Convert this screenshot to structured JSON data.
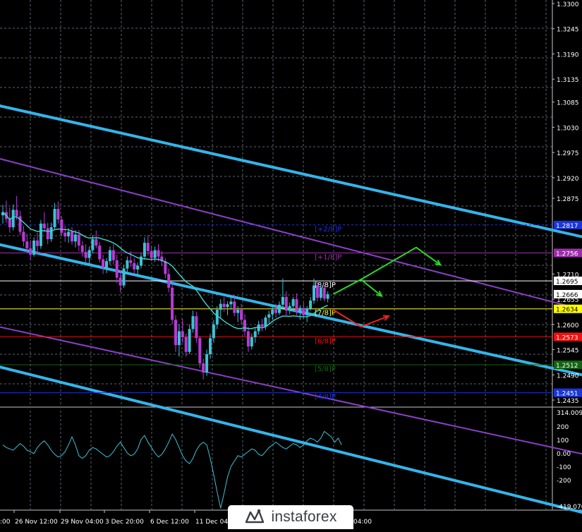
{
  "colors": {
    "background": "#000000",
    "grid": "#5a6670",
    "candle_up": "#3ec1d6",
    "candle_down": "#b73bd6",
    "ma": "#3fd8cf",
    "channel_main": "#33b5ea",
    "channel_inner": "#8a3fc6",
    "axis_text": "#ffffff",
    "cci": "#3ec1d6",
    "arrow_up": "#22dd22",
    "arrow_down": "#ee2222"
  },
  "chart_data": [
    {
      "type": "candlestick",
      "instrument_note": "",
      "x_ticks": [
        "26 Nov 12:00",
        "29 Nov 04:00",
        "3 Dec 20:00",
        "6 Dec 12:00",
        "11 Dec 04:00",
        "04:00"
      ],
      "x_tick_first": ":00",
      "ylim": [
        1.2435,
        1.33
      ],
      "y_ticks": [
        "1.3300",
        "1.3245",
        "1.3190",
        "1.3135",
        "1.3085",
        "1.3030",
        "1.2975",
        "1.2920",
        "1.2875",
        "1.2710",
        "1.2655",
        "1.2600",
        "1.2545",
        "1.2490",
        "1.2435"
      ],
      "price_tags": [
        {
          "value": "1.2695",
          "bg": "#ffffff",
          "fg": "#000000"
        },
        {
          "value": "1.2666",
          "bg": "#ffffff",
          "fg": "#000000"
        },
        {
          "value": "1.2634",
          "bg": "#ffff00",
          "fg": "#000000"
        },
        {
          "value": "1.2573",
          "bg": "#ee1111",
          "fg": "#ffffff"
        },
        {
          "value": "1.2512",
          "bg": "#126312",
          "fg": "#ffffff"
        },
        {
          "value": "1.2451",
          "bg": "#1a35d8",
          "fg": "#ffffff"
        },
        {
          "value": "1.2756",
          "bg": "#9b2fa8",
          "fg": "#ffffff"
        },
        {
          "value": "1.2817",
          "bg": "#1a35d8",
          "fg": "#ffffff"
        }
      ],
      "murray_levels": [
        {
          "label": "[+2/8]P",
          "value": 1.2817,
          "color": "#2233dd",
          "style": "dash"
        },
        {
          "label": "[+1/8]P",
          "value": 1.2756,
          "color": "#a02fb0",
          "style": "solid"
        },
        {
          "label": "[8/8]P",
          "value": 1.2695,
          "color": "#ffffff",
          "style": "solid"
        },
        {
          "label": "[7/8]P",
          "value": 1.2634,
          "color": "#ffff33",
          "style": "solid"
        },
        {
          "label": "[6/8]P",
          "value": 1.2573,
          "color": "#ee1111",
          "style": "solid"
        },
        {
          "label": "[5/8]P",
          "value": 1.2512,
          "color": "#126312",
          "style": "solid"
        },
        {
          "label": "[4/8]P",
          "value": 1.2451,
          "color": "#1a35d8",
          "style": "solid"
        }
      ],
      "last_price": 1.2666,
      "candles": [
        [
          1.2838,
          1.2861,
          1.282,
          1.2845
        ],
        [
          1.2845,
          1.287,
          1.2822,
          1.283
        ],
        [
          1.283,
          1.2855,
          1.28,
          1.2812
        ],
        [
          1.2812,
          1.2862,
          1.2805,
          1.285
        ],
        [
          1.285,
          1.288,
          1.2828,
          1.2836
        ],
        [
          1.2836,
          1.2848,
          1.2795,
          1.2802
        ],
        [
          1.2802,
          1.2815,
          1.277,
          1.2781
        ],
        [
          1.2781,
          1.2798,
          1.2758,
          1.2766
        ],
        [
          1.2766,
          1.2784,
          1.274,
          1.2752
        ],
        [
          1.2752,
          1.279,
          1.2748,
          1.2783
        ],
        [
          1.2783,
          1.28,
          1.276,
          1.2771
        ],
        [
          1.2771,
          1.2828,
          1.2765,
          1.282
        ],
        [
          1.282,
          1.2845,
          1.2802,
          1.281
        ],
        [
          1.281,
          1.2822,
          1.2775,
          1.2786
        ],
        [
          1.2786,
          1.2822,
          1.278,
          1.2812
        ],
        [
          1.2812,
          1.2865,
          1.2806,
          1.2852
        ],
        [
          1.2852,
          1.2868,
          1.282,
          1.2829
        ],
        [
          1.2829,
          1.2836,
          1.2792,
          1.28
        ],
        [
          1.28,
          1.2815,
          1.278,
          1.2792
        ],
        [
          1.2792,
          1.281,
          1.2778,
          1.2802
        ],
        [
          1.2802,
          1.2812,
          1.2774,
          1.2781
        ],
        [
          1.2781,
          1.2806,
          1.2768,
          1.2796
        ],
        [
          1.2796,
          1.2806,
          1.276,
          1.2772
        ],
        [
          1.2772,
          1.2782,
          1.2748,
          1.2758
        ],
        [
          1.2758,
          1.2775,
          1.2735,
          1.2745
        ],
        [
          1.2745,
          1.277,
          1.2732,
          1.2762
        ],
        [
          1.2762,
          1.2795,
          1.2755,
          1.2786
        ],
        [
          1.2786,
          1.2805,
          1.2766,
          1.2772
        ],
        [
          1.2772,
          1.278,
          1.2735,
          1.2742
        ],
        [
          1.2742,
          1.2752,
          1.271,
          1.2724
        ],
        [
          1.2724,
          1.2745,
          1.2712,
          1.2738
        ],
        [
          1.2738,
          1.277,
          1.273,
          1.2762
        ],
        [
          1.2762,
          1.2775,
          1.273,
          1.274
        ],
        [
          1.274,
          1.2752,
          1.269,
          1.2702
        ],
        [
          1.2702,
          1.2718,
          1.267,
          1.2685
        ],
        [
          1.2685,
          1.273,
          1.268,
          1.2722
        ],
        [
          1.2722,
          1.2748,
          1.271,
          1.274
        ],
        [
          1.274,
          1.276,
          1.2725,
          1.2734
        ],
        [
          1.2734,
          1.2745,
          1.2712,
          1.272
        ],
        [
          1.272,
          1.2735,
          1.2705,
          1.2728
        ],
        [
          1.2728,
          1.2755,
          1.2722,
          1.2748
        ],
        [
          1.2748,
          1.279,
          1.2742,
          1.2778
        ],
        [
          1.2778,
          1.2795,
          1.275,
          1.276
        ],
        [
          1.276,
          1.2772,
          1.2738,
          1.2745
        ],
        [
          1.2745,
          1.277,
          1.2736,
          1.2762
        ],
        [
          1.2762,
          1.2775,
          1.2738,
          1.2748
        ],
        [
          1.2748,
          1.276,
          1.2728,
          1.2738
        ],
        [
          1.2738,
          1.2745,
          1.27,
          1.271
        ],
        [
          1.271,
          1.2722,
          1.267,
          1.268
        ],
        [
          1.268,
          1.269,
          1.26,
          1.261
        ],
        [
          1.261,
          1.262,
          1.254,
          1.2555
        ],
        [
          1.2555,
          1.26,
          1.253,
          1.2585
        ],
        [
          1.2585,
          1.2612,
          1.256,
          1.2572
        ],
        [
          1.2572,
          1.258,
          1.253,
          1.254
        ],
        [
          1.254,
          1.26,
          1.2535,
          1.259
        ],
        [
          1.259,
          1.263,
          1.2582,
          1.2618
        ],
        [
          1.2618,
          1.2628,
          1.256,
          1.257
        ],
        [
          1.257,
          1.2575,
          1.2505,
          1.2515
        ],
        [
          1.2515,
          1.2525,
          1.248,
          1.2495
        ],
        [
          1.2495,
          1.2545,
          1.2488,
          1.2535
        ],
        [
          1.2535,
          1.258,
          1.2525,
          1.257
        ],
        [
          1.257,
          1.261,
          1.256,
          1.26
        ],
        [
          1.26,
          1.264,
          1.259,
          1.2632
        ],
        [
          1.2632,
          1.2655,
          1.2615,
          1.2645
        ],
        [
          1.2645,
          1.266,
          1.2628,
          1.2638
        ],
        [
          1.2638,
          1.265,
          1.262,
          1.2644
        ],
        [
          1.2644,
          1.2662,
          1.2632,
          1.265
        ],
        [
          1.265,
          1.266,
          1.2618,
          1.2625
        ],
        [
          1.2625,
          1.264,
          1.2605,
          1.2632
        ],
        [
          1.2632,
          1.2645,
          1.26,
          1.261
        ],
        [
          1.261,
          1.2622,
          1.2575,
          1.2585
        ],
        [
          1.2585,
          1.2595,
          1.254,
          1.2552
        ],
        [
          1.2552,
          1.258,
          1.2545,
          1.2572
        ],
        [
          1.2572,
          1.2592,
          1.256,
          1.2585
        ],
        [
          1.2585,
          1.2608,
          1.2578,
          1.26
        ],
        [
          1.26,
          1.2612,
          1.2585,
          1.2595
        ],
        [
          1.2595,
          1.262,
          1.2588,
          1.2615
        ],
        [
          1.2615,
          1.263,
          1.26,
          1.2622
        ],
        [
          1.2622,
          1.264,
          1.261,
          1.2632
        ],
        [
          1.2632,
          1.2645,
          1.2615,
          1.2625
        ],
        [
          1.2625,
          1.265,
          1.262,
          1.2643
        ],
        [
          1.2643,
          1.27,
          1.2638,
          1.266
        ],
        [
          1.266,
          1.2672,
          1.262,
          1.263
        ],
        [
          1.263,
          1.2648,
          1.2622,
          1.264
        ],
        [
          1.264,
          1.266,
          1.263,
          1.2655
        ],
        [
          1.2655,
          1.2668,
          1.262,
          1.2628
        ],
        [
          1.2628,
          1.2642,
          1.261,
          1.2636
        ],
        [
          1.2636,
          1.2648,
          1.2612,
          1.262
        ],
        [
          1.262,
          1.264,
          1.2605,
          1.2635
        ],
        [
          1.2635,
          1.266,
          1.263,
          1.2652
        ],
        [
          1.2652,
          1.27,
          1.2645,
          1.2685
        ],
        [
          1.2685,
          1.2695,
          1.265,
          1.2658
        ],
        [
          1.2658,
          1.269,
          1.2652,
          1.268
        ],
        [
          1.268,
          1.2686,
          1.265,
          1.2656
        ],
        [
          1.2656,
          1.2672,
          1.2648,
          1.2666
        ]
      ],
      "ma_period": 20,
      "channels": [
        {
          "role": "main",
          "from": [
            -10,
            1.3093
          ],
          "to": [
            200,
            1.2737
          ]
        },
        {
          "role": "main",
          "from": [
            -10,
            1.279
          ],
          "to": [
            200,
            1.2436
          ]
        },
        {
          "role": "main",
          "from": [
            -10,
            1.2525
          ],
          "to": [
            200,
            1.213
          ]
        },
        {
          "role": "inner",
          "from": [
            -10,
            1.298
          ],
          "to": [
            200,
            1.257
          ]
        },
        {
          "role": "inner",
          "from": [
            -10,
            1.261
          ],
          "to": [
            200,
            1.2265
          ]
        }
      ],
      "forecast_arrows": [
        {
          "color": "green",
          "points": [
            [
              96,
              1.2666
            ],
            [
              104,
              1.2698
            ],
            [
              110,
              1.2662
            ]
          ]
        },
        {
          "color": "green",
          "points": [
            [
              104,
              1.2698
            ],
            [
              120,
              1.2768
            ],
            [
              127,
              1.273
            ]
          ]
        },
        {
          "color": "red",
          "points": [
            [
              96,
              1.2632
            ],
            [
              104,
              1.2595
            ],
            [
              112,
              1.2618
            ]
          ]
        }
      ]
    },
    {
      "type": "line",
      "series": [
        {
          "values": [
            60,
            40,
            30,
            20,
            45,
            70,
            50,
            20,
            10,
            -5,
            40,
            70,
            90,
            60,
            20,
            -10,
            -30,
            -20,
            10,
            60,
            120,
            60,
            -20,
            -40,
            -20,
            20,
            40,
            30,
            10,
            -10,
            -30,
            -20,
            10,
            50,
            80,
            40,
            0,
            -20,
            -10,
            30,
            100,
            130,
            80,
            40,
            0,
            -30,
            -10,
            30,
            80,
            140,
            100,
            40,
            -20,
            -60,
            -80,
            -40,
            20,
            60,
            80,
            60,
            -40,
            -160,
            -290,
            -410,
            -300,
            -180,
            -100,
            -60,
            -20,
            -30,
            -10,
            10,
            30,
            20,
            -10,
            -20,
            10,
            40,
            60,
            80,
            60,
            40,
            30,
            50,
            70,
            60,
            40,
            60,
            90,
            110,
            100,
            80,
            110,
            160,
            140,
            120,
            80,
            110,
            60
          ]
        }
      ],
      "ylim": [
        -419.076,
        314.0099
      ],
      "y_ticks": [
        "314.0099",
        "200",
        "100",
        "0.00",
        "-100",
        "-200",
        "-419.076"
      ]
    }
  ],
  "watermark": {
    "text": "instaforex"
  }
}
